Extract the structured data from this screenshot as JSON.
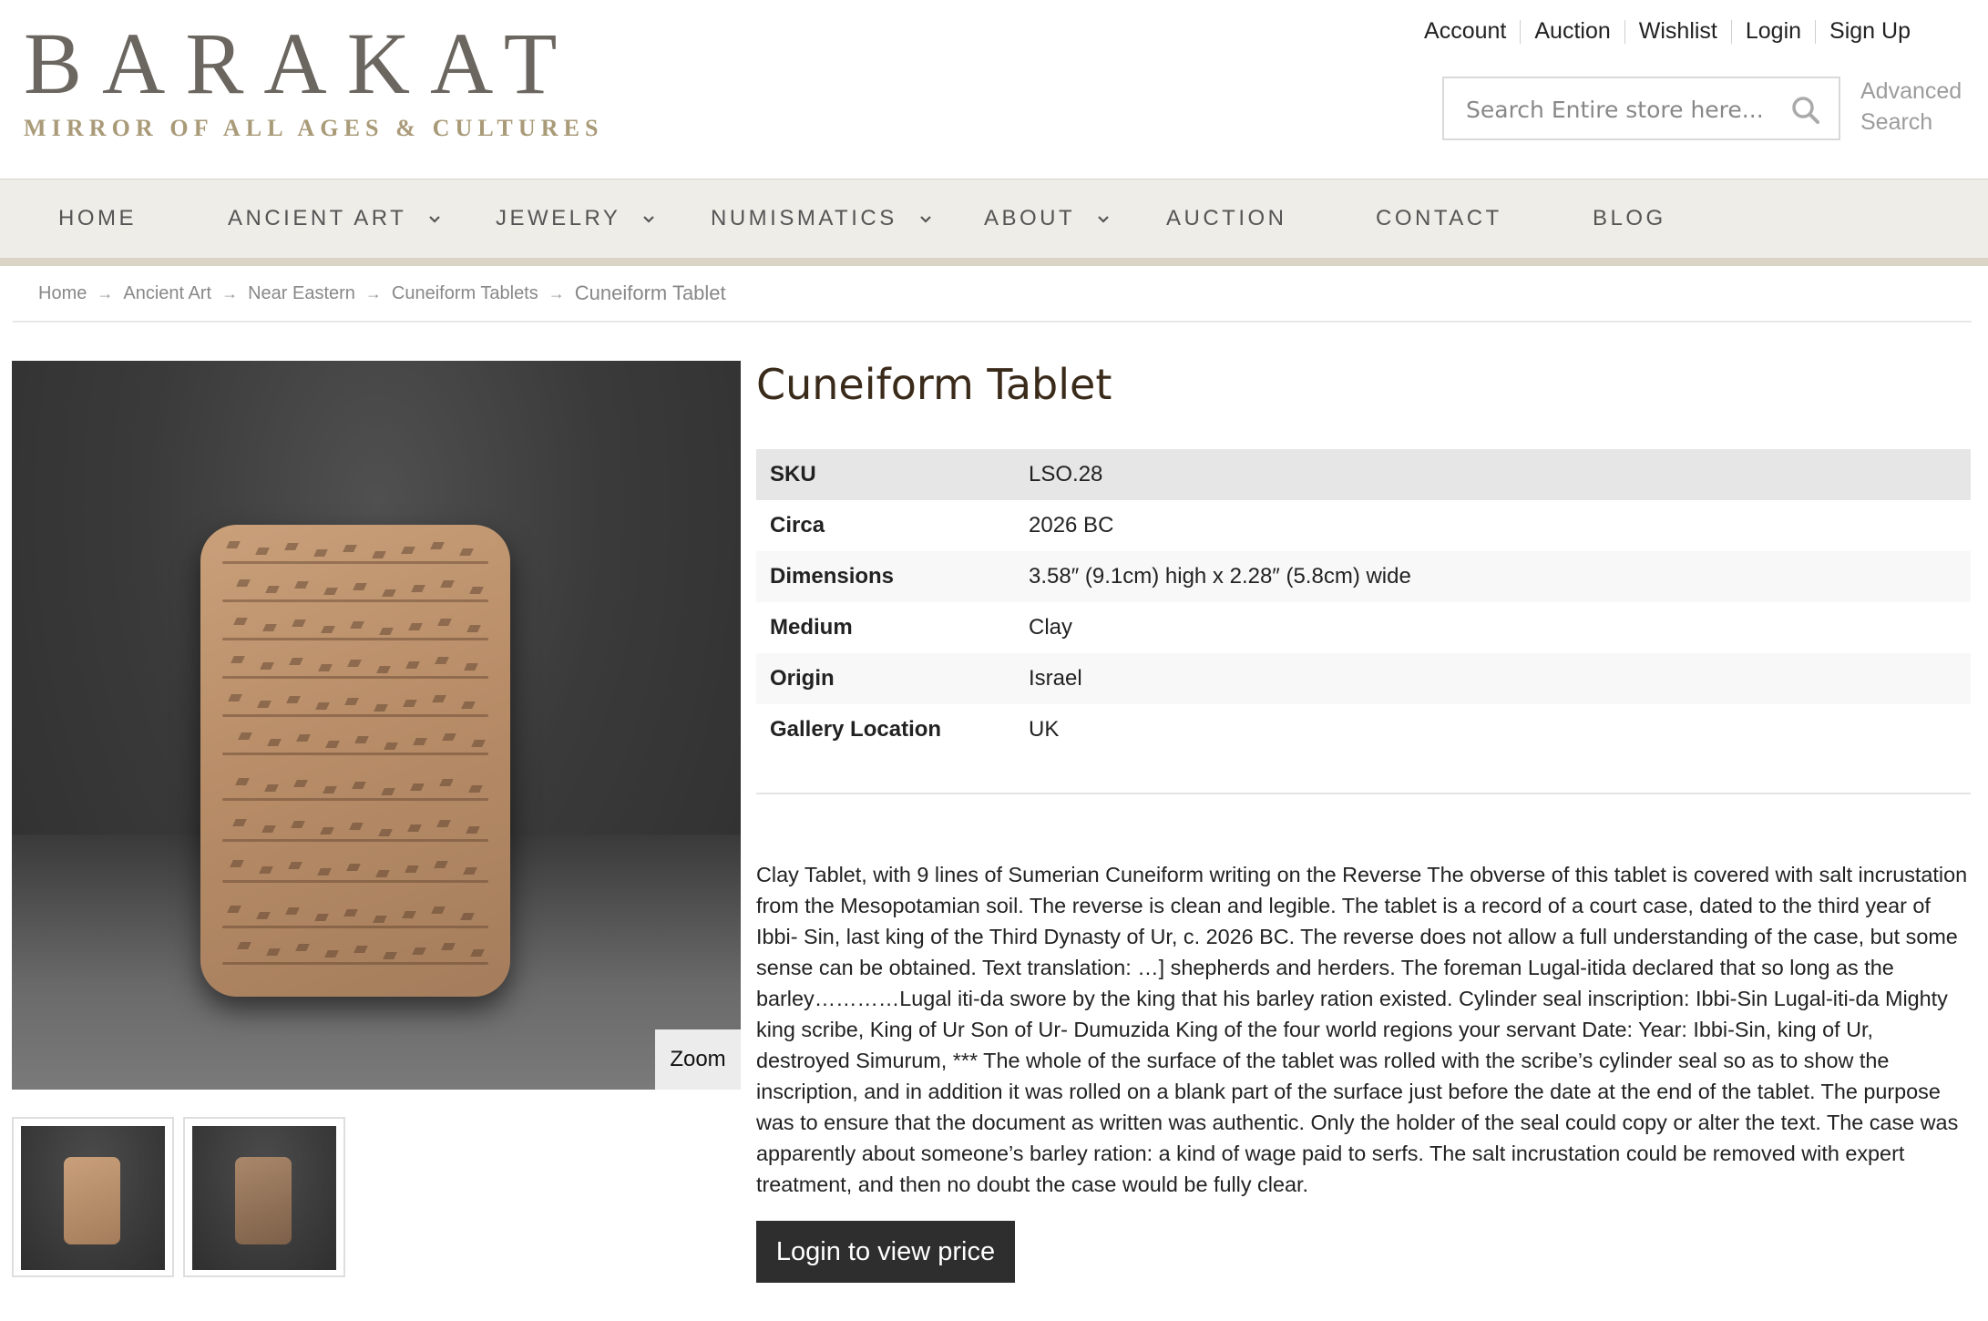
{
  "brand": {
    "name": "BARAKAT",
    "tagline": "MIRROR OF ALL AGES & CULTURES"
  },
  "header": {
    "links": [
      "Account",
      "Auction",
      "Wishlist",
      "Login",
      "Sign Up"
    ],
    "search_placeholder": "Search Entire store here...",
    "advanced_search_line1": "Advanced",
    "advanced_search_line2": "Search",
    "search_icon": "search-icon"
  },
  "nav": {
    "items": [
      {
        "label": "HOME",
        "has_dropdown": false
      },
      {
        "label": "ANCIENT ART",
        "has_dropdown": true
      },
      {
        "label": "JEWELRY",
        "has_dropdown": true
      },
      {
        "label": "NUMISMATICS",
        "has_dropdown": true
      },
      {
        "label": "ABOUT",
        "has_dropdown": true
      },
      {
        "label": "AUCTION",
        "has_dropdown": false
      },
      {
        "label": "CONTACT",
        "has_dropdown": false
      },
      {
        "label": "BLOG",
        "has_dropdown": false
      }
    ]
  },
  "breadcrumb": {
    "items": [
      "Home",
      "Ancient Art",
      "Near Eastern",
      "Cuneiform Tablets"
    ],
    "current": "Cuneiform Tablet",
    "separator": "→"
  },
  "gallery": {
    "zoom_label": "Zoom",
    "thumbnail_count": 2
  },
  "product": {
    "title": "Cuneiform Tablet",
    "attributes": [
      {
        "key": "SKU",
        "value": "LSO.28"
      },
      {
        "key": "Circa",
        "value": "2026 BC"
      },
      {
        "key": "Dimensions",
        "value": "3.58″ (9.1cm) high x 2.28″ (5.8cm) wide"
      },
      {
        "key": "Medium",
        "value": "Clay"
      },
      {
        "key": "Origin",
        "value": "Israel"
      },
      {
        "key": "Gallery Location",
        "value": "UK"
      }
    ],
    "description": "Clay Tablet, with 9 lines of Sumerian Cuneiform writing on the Reverse The obverse of this tablet is covered with salt incrustation from the Mesopotamian soil. The reverse is clean and legible. The tablet is a record of a court case, dated to the third year of Ibbi- Sin, last king of the Third Dynasty of Ur, c. 2026 BC. The reverse does not allow a full understanding of the case, but some sense can be obtained. Text translation: …] shepherds and herders. The foreman Lugal-itida declared that so long as the barley…………Lugal iti-da swore by the king that his barley ration existed. Cylinder seal inscription: Ibbi-Sin Lugal-iti-da Mighty king scribe, King of Ur Son of Ur- Dumuzida King of the four world regions your servant Date: Year: Ibbi-Sin, king of Ur, destroyed Simurum, *** The whole of the surface of the tablet was rolled with the scribe’s cylinder seal so as to show the inscription, and in addition it was rolled on a blank part of the surface just before the date at the end of the tablet. The purpose was to ensure that the document as written was authentic. Only the holder of the seal could copy or alter the text. The case was apparently about someone’s barley ration: a kind of wage paid to serfs. The salt incrustation could be removed with expert treatment, and then no doubt the case would be fully clear.",
    "login_button": "Login to view price"
  },
  "colors": {
    "nav_bg": "#efede8",
    "logo_main": "#6b6660",
    "logo_sub": "#a99a78",
    "title": "#3a2a1a",
    "button_bg": "#2e2e2e"
  }
}
